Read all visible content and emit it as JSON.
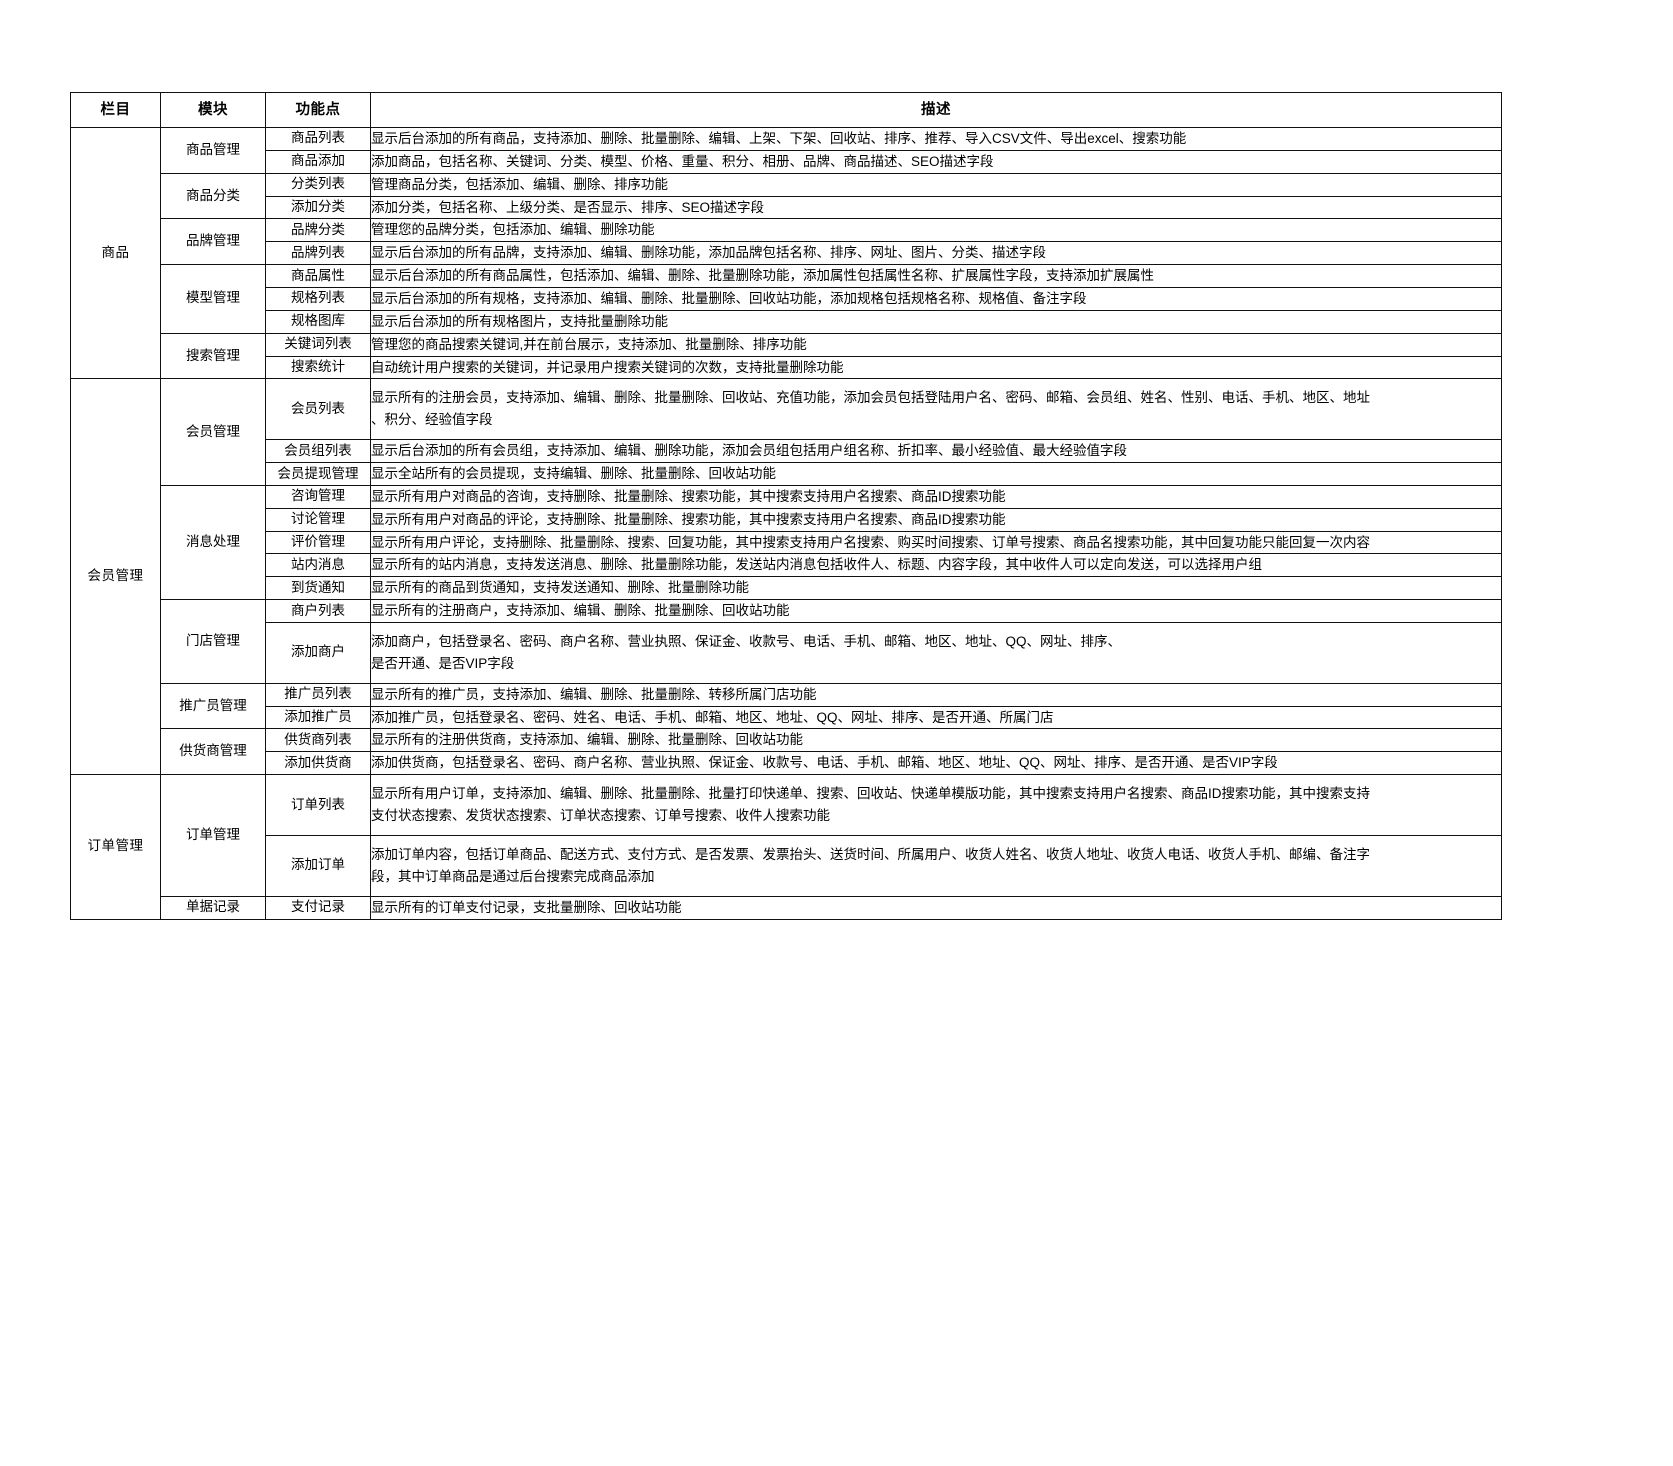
{
  "table": {
    "headers": [
      "栏目",
      "模块",
      "功能点",
      "描述"
    ],
    "sections": [
      {
        "column": "商品",
        "modules": [
          {
            "module": "商品管理",
            "rows": [
              {
                "feature": "商品列表",
                "desc": "显示后台添加的所有商品，支持添加、删除、批量删除、编辑、上架、下架、回收站、排序、推荐、导入CSV文件、导出excel、搜索功能"
              },
              {
                "feature": "商品添加",
                "desc": "添加商品，包括名称、关键词、分类、模型、价格、重量、积分、相册、品牌、商品描述、SEO描述字段"
              }
            ]
          },
          {
            "module": "商品分类",
            "rows": [
              {
                "feature": "分类列表",
                "desc": "管理商品分类，包括添加、编辑、删除、排序功能"
              },
              {
                "feature": "添加分类",
                "desc": "添加分类，包括名称、上级分类、是否显示、排序、SEO描述字段"
              }
            ]
          },
          {
            "module": "品牌管理",
            "rows": [
              {
                "feature": "品牌分类",
                "desc": "管理您的品牌分类，包括添加、编辑、删除功能"
              },
              {
                "feature": "品牌列表",
                "desc": "显示后台添加的所有品牌，支持添加、编辑、删除功能，添加品牌包括名称、排序、网址、图片、分类、描述字段"
              }
            ]
          },
          {
            "module": "模型管理",
            "rows": [
              {
                "feature": "商品属性",
                "desc": "显示后台添加的所有商品属性，包括添加、编辑、删除、批量删除功能，添加属性包括属性名称、扩展属性字段，支持添加扩展属性"
              },
              {
                "feature": "规格列表",
                "desc": "显示后台添加的所有规格，支持添加、编辑、删除、批量删除、回收站功能，添加规格包括规格名称、规格值、备注字段"
              },
              {
                "feature": "规格图库",
                "desc": "显示后台添加的所有规格图片，支持批量删除功能"
              }
            ]
          },
          {
            "module": "搜索管理",
            "rows": [
              {
                "feature": "关键词列表",
                "desc": "管理您的商品搜索关键词,并在前台展示，支持添加、批量删除、排序功能"
              },
              {
                "feature": "搜索统计",
                "desc": "自动统计用户搜索的关键词，并记录用户搜索关键词的次数，支持批量删除功能"
              }
            ]
          }
        ]
      },
      {
        "column": "会员管理",
        "modules": [
          {
            "module": "会员管理",
            "rows": [
              {
                "feature": "会员列表",
                "desc_lines": [
                  "显示所有的注册会员，支持添加、编辑、删除、批量删除、回收站、充值功能，添加会员包括登陆用户名、密码、邮箱、会员组、姓名、性别、电话、手机、地区、地址",
                  "、积分、经验值字段"
                ]
              },
              {
                "feature": "会员组列表",
                "desc": "显示后台添加的所有会员组，支持添加、编辑、删除功能，添加会员组包括用户组名称、折扣率、最小经验值、最大经验值字段"
              },
              {
                "feature": "会员提现管理",
                "desc": "显示全站所有的会员提现，支持编辑、删除、批量删除、回收站功能"
              }
            ]
          },
          {
            "module": "消息处理",
            "rows": [
              {
                "feature": "咨询管理",
                "desc": "显示所有用户对商品的咨询，支持删除、批量删除、搜索功能，其中搜索支持用户名搜索、商品ID搜索功能"
              },
              {
                "feature": "讨论管理",
                "desc": "显示所有用户对商品的评论，支持删除、批量删除、搜索功能，其中搜索支持用户名搜索、商品ID搜索功能"
              },
              {
                "feature": "评价管理",
                "desc": "显示所有用户评论，支持删除、批量删除、搜索、回复功能，其中搜索支持用户名搜索、购买时间搜索、订单号搜索、商品名搜索功能，其中回复功能只能回复一次内容"
              },
              {
                "feature": "站内消息",
                "desc": "显示所有的站内消息，支持发送消息、删除、批量删除功能，发送站内消息包括收件人、标题、内容字段，其中收件人可以定向发送，可以选择用户组"
              },
              {
                "feature": "到货通知",
                "desc": "显示所有的商品到货通知，支持发送通知、删除、批量删除功能"
              }
            ]
          },
          {
            "module": "门店管理",
            "rows": [
              {
                "feature": "商户列表",
                "desc": "显示所有的注册商户，支持添加、编辑、删除、批量删除、回收站功能"
              },
              {
                "feature": "添加商户",
                "desc_lines": [
                  "添加商户，包括登录名、密码、商户名称、营业执照、保证金、收款号、电话、手机、邮箱、地区、地址、QQ、网址、排序、",
                  "是否开通、是否VIP字段"
                ]
              }
            ]
          },
          {
            "module": "推广员管理",
            "rows": [
              {
                "feature": "推广员列表",
                "desc": "显示所有的推广员，支持添加、编辑、删除、批量删除、转移所属门店功能"
              },
              {
                "feature": "添加推广员",
                "desc": "添加推广员，包括登录名、密码、姓名、电话、手机、邮箱、地区、地址、QQ、网址、排序、是否开通、所属门店"
              }
            ]
          },
          {
            "module": "供货商管理",
            "rows": [
              {
                "feature": "供货商列表",
                "desc": "显示所有的注册供货商，支持添加、编辑、删除、批量删除、回收站功能"
              },
              {
                "feature": "添加供货商",
                "desc": "添加供货商，包括登录名、密码、商户名称、营业执照、保证金、收款号、电话、手机、邮箱、地区、地址、QQ、网址、排序、是否开通、是否VIP字段"
              }
            ]
          }
        ]
      },
      {
        "column": "订单管理",
        "modules": [
          {
            "module": "订单管理",
            "rows": [
              {
                "feature": "订单列表",
                "desc_lines": [
                  "显示所有用户订单，支持添加、编辑、删除、批量删除、批量打印快递单、搜索、回收站、快递单模版功能，其中搜索支持用户名搜索、商品ID搜索功能，其中搜索支持",
                  "支付状态搜索、发货状态搜索、订单状态搜索、订单号搜索、收件人搜索功能"
                ]
              },
              {
                "feature": "添加订单",
                "desc_lines": [
                  "添加订单内容，包括订单商品、配送方式、支付方式、是否发票、发票抬头、送货时间、所属用户、收货人姓名、收货人地址、收货人电话、收货人手机、邮编、备注字",
                  "段，其中订单商品是通过后台搜索完成商品添加"
                ]
              }
            ]
          },
          {
            "module": "单据记录",
            "rows": [
              {
                "feature": "支付记录",
                "desc": "显示所有的订单支付记录，支批量删除、回收站功能"
              }
            ]
          }
        ]
      }
    ]
  }
}
